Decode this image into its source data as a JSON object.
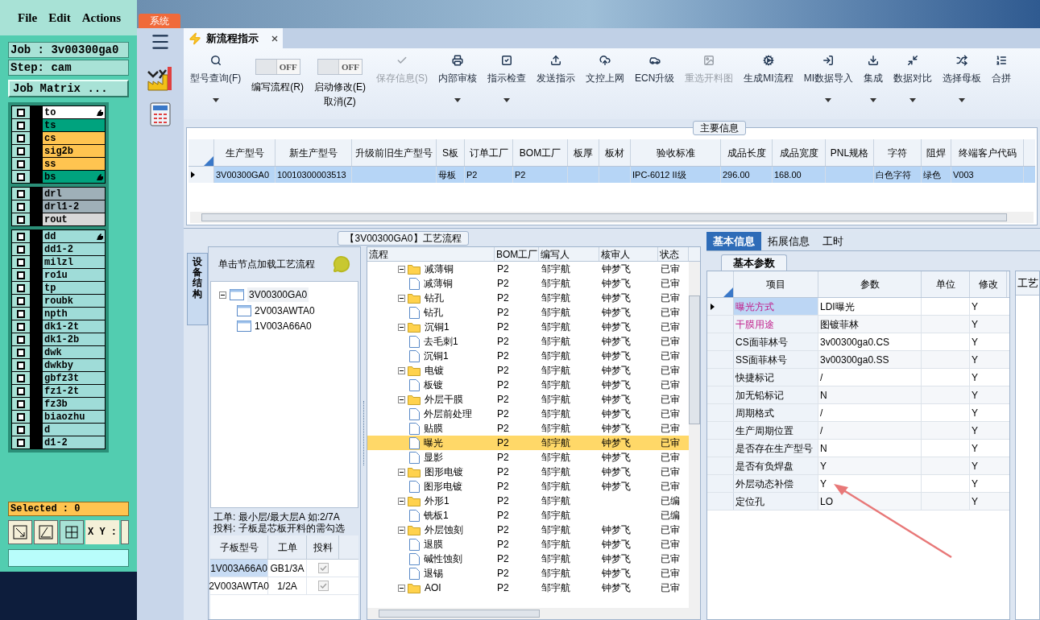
{
  "left_panel": {
    "menu": [
      "File",
      "Edit",
      "Actions"
    ],
    "job": "Job : 3v00300ga0",
    "step": "Step: cam",
    "matrix_button": "Job Matrix ...",
    "layer_groups": [
      {
        "layers": [
          {
            "name": "to",
            "color": "#ffffff",
            "checked": false,
            "marked": true
          },
          {
            "name": "ts",
            "color": "#00a37e",
            "checked": false,
            "marked": false
          },
          {
            "name": "cs",
            "color": "#ffc450",
            "checked": false,
            "marked": false
          },
          {
            "name": "sig2b",
            "color": "#ffc450",
            "checked": false,
            "marked": false
          },
          {
            "name": "ss",
            "color": "#ffc450",
            "checked": false,
            "marked": false
          },
          {
            "name": "bs",
            "color": "#00a37e",
            "checked": false,
            "marked": true
          }
        ]
      },
      {
        "layers": [
          {
            "name": "drl",
            "color": "#9fb0b8",
            "checked": false,
            "marked": false
          },
          {
            "name": "drl1-2",
            "color": "#9fb0b8",
            "checked": false,
            "marked": false
          },
          {
            "name": "rout",
            "color": "#d8d8d8",
            "checked": false,
            "marked": false
          }
        ]
      },
      {
        "layers": [
          {
            "name": "dd",
            "color": "#9fdcd8",
            "checked": false,
            "marked": true
          },
          {
            "name": "dd1-2",
            "color": "#9fdcd8",
            "checked": false,
            "marked": false
          },
          {
            "name": "milzl",
            "color": "#9fdcd8",
            "checked": false,
            "marked": false
          },
          {
            "name": "ro1u",
            "color": "#9fdcd8",
            "checked": false,
            "marked": false
          },
          {
            "name": "tp",
            "color": "#9fdcd8",
            "checked": false,
            "marked": false
          },
          {
            "name": "roubk",
            "color": "#9fdcd8",
            "checked": false,
            "marked": false
          },
          {
            "name": "npth",
            "color": "#9fdcd8",
            "checked": false,
            "marked": false
          },
          {
            "name": "dk1-2t",
            "color": "#9fdcd8",
            "checked": false,
            "marked": false
          },
          {
            "name": "dk1-2b",
            "color": "#9fdcd8",
            "checked": false,
            "marked": false
          },
          {
            "name": "dwk",
            "color": "#9fdcd8",
            "checked": false,
            "marked": false
          },
          {
            "name": "dwkby",
            "color": "#9fdcd8",
            "checked": false,
            "marked": false
          },
          {
            "name": "gbfz3t",
            "color": "#9fdcd8",
            "checked": false,
            "marked": false
          },
          {
            "name": "fz1-2t",
            "color": "#9fdcd8",
            "checked": false,
            "marked": false
          },
          {
            "name": "fz3b",
            "color": "#9fdcd8",
            "checked": false,
            "marked": false
          },
          {
            "name": "biaozhu",
            "color": "#9fdcd8",
            "checked": false,
            "marked": false
          },
          {
            "name": "d",
            "color": "#9fdcd8",
            "checked": false,
            "marked": false
          },
          {
            "name": "d1-2",
            "color": "#9fdcd8",
            "checked": false,
            "marked": false
          }
        ]
      }
    ],
    "selected_count": "Selected : 0",
    "coord_label": "X Y :"
  },
  "system_tab": "系统",
  "doc_tab": {
    "title": "新流程指示",
    "selected": true
  },
  "toolbar": [
    {
      "kind": "button",
      "label": "型号查询(F)",
      "disabled": false,
      "dropdown": true
    },
    {
      "kind": "toggle",
      "label": "编写流程(R)",
      "state_text": "OFF",
      "on": false
    },
    {
      "kind": "toggle",
      "label": "启动修改(E)",
      "sublabel": "取消(Z)",
      "state_text": "OFF",
      "on": false
    },
    {
      "kind": "button",
      "label": "保存信息(S)",
      "disabled": true,
      "dropdown": false
    },
    {
      "kind": "button",
      "label": "内部审核",
      "disabled": false,
      "dropdown": true
    },
    {
      "kind": "button",
      "label": "指示检查",
      "disabled": false,
      "dropdown": true
    },
    {
      "kind": "button",
      "label": "发送指示",
      "disabled": false,
      "dropdown": false
    },
    {
      "kind": "button",
      "label": "文控上网",
      "disabled": false,
      "dropdown": false
    },
    {
      "kind": "button",
      "label": "ECN升级",
      "disabled": false,
      "dropdown": false
    },
    {
      "kind": "button",
      "label": "重选开料图",
      "disabled": true,
      "dropdown": false
    },
    {
      "kind": "button",
      "label": "生成MI流程",
      "disabled": false,
      "dropdown": false
    },
    {
      "kind": "button",
      "label": "MI数据导入",
      "disabled": false,
      "dropdown": true
    },
    {
      "kind": "button",
      "label": "集成",
      "disabled": false,
      "dropdown": true
    },
    {
      "kind": "button",
      "label": "数据对比",
      "disabled": false,
      "dropdown": true
    },
    {
      "kind": "button",
      "label": "选择母板",
      "disabled": false,
      "dropdown": true
    },
    {
      "kind": "button",
      "label": "合拼",
      "disabled": false,
      "dropdown": false
    }
  ],
  "main_info": {
    "caption": "主要信息",
    "columns": [
      "生产型号",
      "新生产型号",
      "升级前旧生产型号",
      "S板",
      "订单工厂",
      "BOM工厂",
      "板厚",
      "板材",
      "验收标准",
      "成品长度",
      "成品宽度",
      "PNL规格",
      "字符",
      "阻焊",
      "终端客户代码"
    ],
    "rows": [
      {
        "selected": true,
        "cells": [
          "3V00300GA0",
          "10010300003513",
          null,
          "母板",
          "P2",
          "P2",
          null,
          null,
          "IPC-6012 II级",
          "296.00",
          "168.00",
          null,
          "白色字符",
          "绿色",
          "V003"
        ]
      }
    ]
  },
  "process": {
    "caption": "【3V00300GA0】工艺流程",
    "side_tab": "设备结构",
    "hint": "单击节点加载工艺流程",
    "tree": [
      {
        "label": "3V00300GA0",
        "expanded": true,
        "children": [
          {
            "label": "2V003AWTA0"
          },
          {
            "label": "1V003A66A0"
          }
        ]
      }
    ],
    "notes": [
      "工单: 最小层/最大层A 如:2/7A",
      "投料: 子板是芯板开料的需勾选"
    ],
    "board_table": {
      "columns": [
        "子板型号",
        "工单",
        "投料"
      ],
      "rows": [
        {
          "cells": [
            "1V003A66A0",
            "GB1/3A"
          ],
          "checked": true,
          "selected": true
        },
        {
          "cells": [
            "2V003AWTA0",
            "1/2A"
          ],
          "checked": true,
          "selected": false
        }
      ]
    },
    "flow_grid": {
      "columns": [
        "流程",
        "BOM工厂",
        "编写人",
        "核审人",
        "状态"
      ],
      "steps": [
        {
          "name": "减薄铜",
          "bom": "P2",
          "author": "邹宇航",
          "reviewer": "钟梦飞",
          "status": "已审",
          "expanded": true,
          "selected": false,
          "children": [
            {
              "name": "减薄铜",
              "bom": "P2",
              "author": "邹宇航",
              "reviewer": "钟梦飞",
              "status": "已审",
              "selected": false
            }
          ]
        },
        {
          "name": "钻孔",
          "bom": "P2",
          "author": "邹宇航",
          "reviewer": "钟梦飞",
          "status": "已审",
          "expanded": true,
          "selected": false,
          "children": [
            {
              "name": "钻孔",
              "bom": "P2",
              "author": "邹宇航",
              "reviewer": "钟梦飞",
              "status": "已审",
              "selected": false
            }
          ]
        },
        {
          "name": "沉铜1",
          "bom": "P2",
          "author": "邹宇航",
          "reviewer": "钟梦飞",
          "status": "已审",
          "expanded": true,
          "selected": false,
          "children": [
            {
              "name": "去毛刺1",
              "bom": "P2",
              "author": "邹宇航",
              "reviewer": "钟梦飞",
              "status": "已审",
              "selected": false
            },
            {
              "name": "沉铜1",
              "bom": "P2",
              "author": "邹宇航",
              "reviewer": "钟梦飞",
              "status": "已审",
              "selected": false
            }
          ]
        },
        {
          "name": "电镀",
          "bom": "P2",
          "author": "邹宇航",
          "reviewer": "钟梦飞",
          "status": "已审",
          "expanded": true,
          "selected": false,
          "children": [
            {
              "name": "板镀",
              "bom": "P2",
              "author": "邹宇航",
              "reviewer": "钟梦飞",
              "status": "已审",
              "selected": false
            }
          ]
        },
        {
          "name": "外层干膜",
          "bom": "P2",
          "author": "邹宇航",
          "reviewer": "钟梦飞",
          "status": "已审",
          "expanded": true,
          "selected": false,
          "children": [
            {
              "name": "外层前处理",
              "bom": "P2",
              "author": "邹宇航",
              "reviewer": "钟梦飞",
              "status": "已审",
              "selected": false
            },
            {
              "name": "贴膜",
              "bom": "P2",
              "author": "邹宇航",
              "reviewer": "钟梦飞",
              "status": "已审",
              "selected": false
            },
            {
              "name": "曝光",
              "bom": "P2",
              "author": "邹宇航",
              "reviewer": "钟梦飞",
              "status": "已审",
              "selected": true
            },
            {
              "name": "显影",
              "bom": "P2",
              "author": "邹宇航",
              "reviewer": "钟梦飞",
              "status": "已审",
              "selected": false
            }
          ]
        },
        {
          "name": "图形电镀",
          "bom": "P2",
          "author": "邹宇航",
          "reviewer": "钟梦飞",
          "status": "已审",
          "expanded": true,
          "selected": false,
          "children": [
            {
              "name": "图形电镀",
              "bom": "P2",
              "author": "邹宇航",
              "reviewer": "钟梦飞",
              "status": "已审",
              "selected": false
            }
          ]
        },
        {
          "name": "外形1",
          "bom": "P2",
          "author": "邹宇航",
          "status": "已编",
          "expanded": true,
          "selected": false,
          "children": [
            {
              "name": "铣板1",
              "bom": "P2",
              "author": "邹宇航",
              "status": "已编",
              "selected": false
            }
          ]
        },
        {
          "name": "外层蚀刻",
          "bom": "P2",
          "author": "邹宇航",
          "reviewer": "钟梦飞",
          "status": "已审",
          "expanded": true,
          "selected": false,
          "children": [
            {
              "name": "退膜",
              "bom": "P2",
              "author": "邹宇航",
              "reviewer": "钟梦飞",
              "status": "已审",
              "selected": false
            },
            {
              "name": "碱性蚀刻",
              "bom": "P2",
              "author": "邹宇航",
              "reviewer": "钟梦飞",
              "status": "已审",
              "selected": false
            },
            {
              "name": "退锡",
              "bom": "P2",
              "author": "邹宇航",
              "reviewer": "钟梦飞",
              "status": "已审",
              "selected": false
            }
          ]
        },
        {
          "name": "AOI",
          "bom": "P2",
          "author": "邹宇航",
          "reviewer": "钟梦飞",
          "status": "已审",
          "expanded": true,
          "selected": false
        }
      ]
    }
  },
  "detail": {
    "tabs": [
      {
        "label": "基本信息",
        "selected": true
      },
      {
        "label": "拓展信息",
        "selected": false
      },
      {
        "label": "工时",
        "selected": false
      }
    ],
    "subtab": "基本参数",
    "side_label": "工艺",
    "columns": [
      "项目",
      "参数",
      "单位",
      "修改"
    ],
    "rows": [
      {
        "item": "曝光方式",
        "value": "LDI曝光",
        "modify": "Y",
        "highlighted": true,
        "selected": true
      },
      {
        "item": "干膜用途",
        "value": "图镀菲林",
        "modify": "Y",
        "highlighted": true,
        "selected": false
      },
      {
        "item": "CS面菲林号",
        "value": "3v00300ga0.CS",
        "modify": "Y",
        "highlighted": false,
        "selected": false
      },
      {
        "item": "SS面菲林号",
        "value": "3v00300ga0.SS",
        "modify": "Y",
        "highlighted": false,
        "selected": false
      },
      {
        "item": "快捷标记",
        "value": "/",
        "modify": "Y",
        "highlighted": false,
        "selected": false
      },
      {
        "item": "加无铅标记",
        "value": "N",
        "modify": "Y",
        "highlighted": false,
        "selected": false
      },
      {
        "item": "周期格式",
        "value": "/",
        "modify": "Y",
        "highlighted": false,
        "selected": false
      },
      {
        "item": "生产周期位置",
        "value": "/",
        "modify": "Y",
        "highlighted": false,
        "selected": false
      },
      {
        "item": "是否存在生产型号",
        "value": "N",
        "modify": "Y",
        "highlighted": false,
        "selected": false
      },
      {
        "item": "是否有负焊盘",
        "value": "Y",
        "modify": "Y",
        "highlighted": false,
        "selected": false
      },
      {
        "item": "外层动态补偿",
        "value": "Y",
        "modify": "Y",
        "highlighted": false,
        "selected": false
      },
      {
        "item": "定位孔",
        "value": "LO",
        "modify": "Y",
        "highlighted": false,
        "selected": false
      }
    ]
  }
}
